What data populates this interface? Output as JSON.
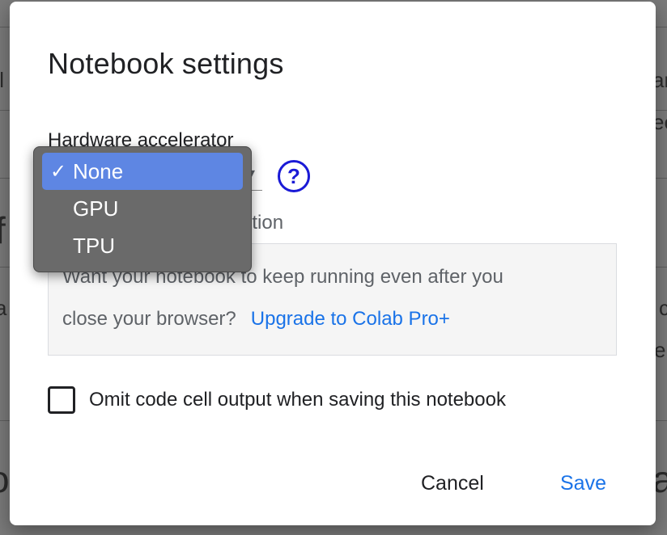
{
  "dialog": {
    "title": "Notebook settings",
    "hardware_label": "Hardware accelerator",
    "help_icon_glyph": "?",
    "background_execution_label_visible": "cution",
    "info": {
      "line1": "Want your notebook to keep running even after you",
      "line2": "close your browser?",
      "upgrade_link": "Upgrade to Colab Pro+"
    },
    "omit_output_label": "Omit code cell output when saving this notebook",
    "omit_output_checked": false,
    "cancel_label": "Cancel",
    "save_label": "Save"
  },
  "dropdown": {
    "check_glyph": "✓",
    "selected": "None",
    "options": [
      "None",
      "GPU",
      "TPU"
    ]
  },
  "background_fragments": [
    "f",
    "a",
    "o",
    "c",
    "tl",
    "ar",
    "ee",
    "c",
    "ep",
    "ac"
  ],
  "colors": {
    "link": "#1a73e8",
    "selected_option": "#5e86e3",
    "help_icon": "#1a1ad6",
    "dropdown_bg": "#6a6a6a"
  }
}
